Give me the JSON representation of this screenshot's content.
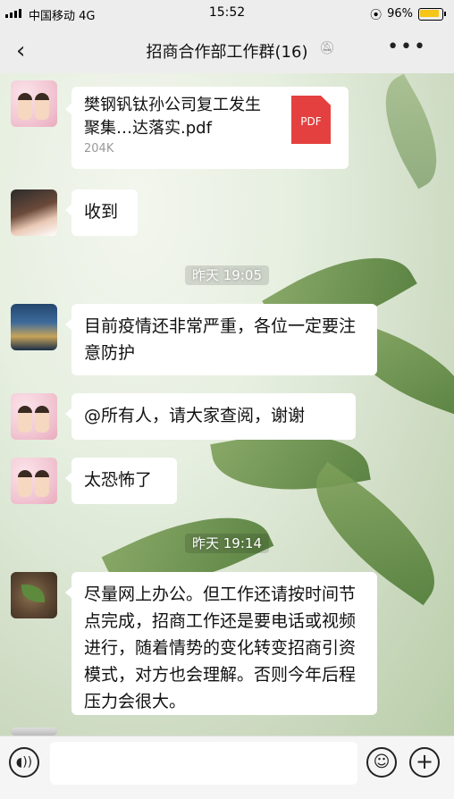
{
  "status_bar": {
    "carrier": "中国移动 4G",
    "time": "15:52",
    "battery": "96%",
    "battery_level": 0.96
  },
  "header": {
    "back_icon": "chevron-left-icon",
    "title": "招商合作部工作群(16)",
    "mute_icon": "bell-off-icon",
    "more_icon": "more-icon"
  },
  "messages": [
    {
      "type": "file",
      "avatar": "couple",
      "file_name": "樊钢钒钛孙公司复工发生聚集…达落实.pdf",
      "file_size": "204K",
      "file_icon": "PDF"
    },
    {
      "type": "text",
      "avatar": "girl",
      "text": "收到"
    },
    {
      "type": "timestamp",
      "text": "昨天 19:05"
    },
    {
      "type": "text",
      "avatar": "city",
      "text": "目前疫情还非常严重，各位一定要注意防护"
    },
    {
      "type": "text",
      "avatar": "couple",
      "text": "@所有人，请大家查阅，谢谢"
    },
    {
      "type": "text",
      "avatar": "couple",
      "text": "太恐怖了"
    },
    {
      "type": "timestamp",
      "text": "昨天 19:14"
    },
    {
      "type": "text",
      "avatar": "wood",
      "text": "尽量网上办公。但工作还请按时间节点完成，招商工作还是要电话或视频进行，随着情势的变化转变招商引资模式，对方也会理解。否则今年后程压力会很大。"
    }
  ],
  "input_bar": {
    "voice_icon": "voice-icon",
    "emoji_icon": "emoji-icon",
    "plus_icon": "plus-icon"
  }
}
